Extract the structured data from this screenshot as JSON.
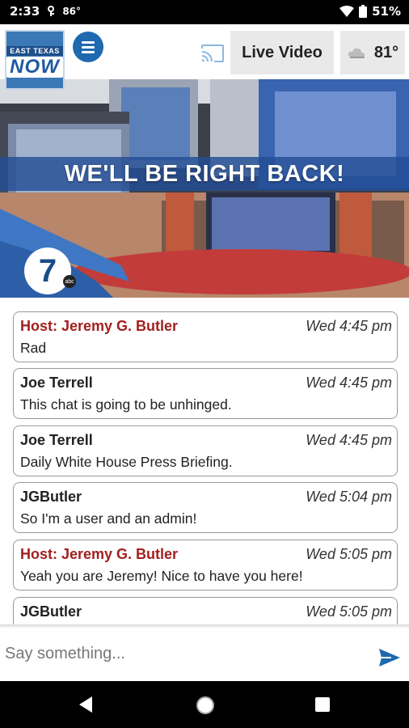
{
  "status_bar": {
    "time": "2:33",
    "temp": "86°",
    "battery": "51%"
  },
  "header": {
    "logo_top": "EAST TEXAS",
    "logo_main": "NOW",
    "live_label": "Live Video",
    "weather_temp": "81°"
  },
  "video": {
    "banner": "WE'LL BE RIGHT BACK!",
    "station": "7"
  },
  "chat": {
    "messages": [
      {
        "author": "Host: Jeremy G. Butler",
        "time": "Wed 4:45 pm",
        "text": "Rad"
      },
      {
        "author": "Joe Terrell",
        "time": "Wed 4:45 pm",
        "text": "This chat is going to be unhinged."
      },
      {
        "author": "Joe Terrell",
        "time": "Wed 4:45 pm",
        "text": "Daily White House Press Briefing."
      },
      {
        "author": "JGButler",
        "time": "Wed 5:04 pm",
        "text": "So I'm a user and an admin!"
      },
      {
        "author": "Host: Jeremy G. Butler",
        "time": "Wed 5:05 pm",
        "text": "Yeah you are Jeremy! Nice to have you here!"
      },
      {
        "author": "JGButler",
        "time": "Wed 5:05 pm",
        "text": ""
      }
    ]
  },
  "input": {
    "placeholder": "Say something..."
  },
  "colors": {
    "host_name": "#a31f1f",
    "accent_blue": "#1e69b0"
  }
}
